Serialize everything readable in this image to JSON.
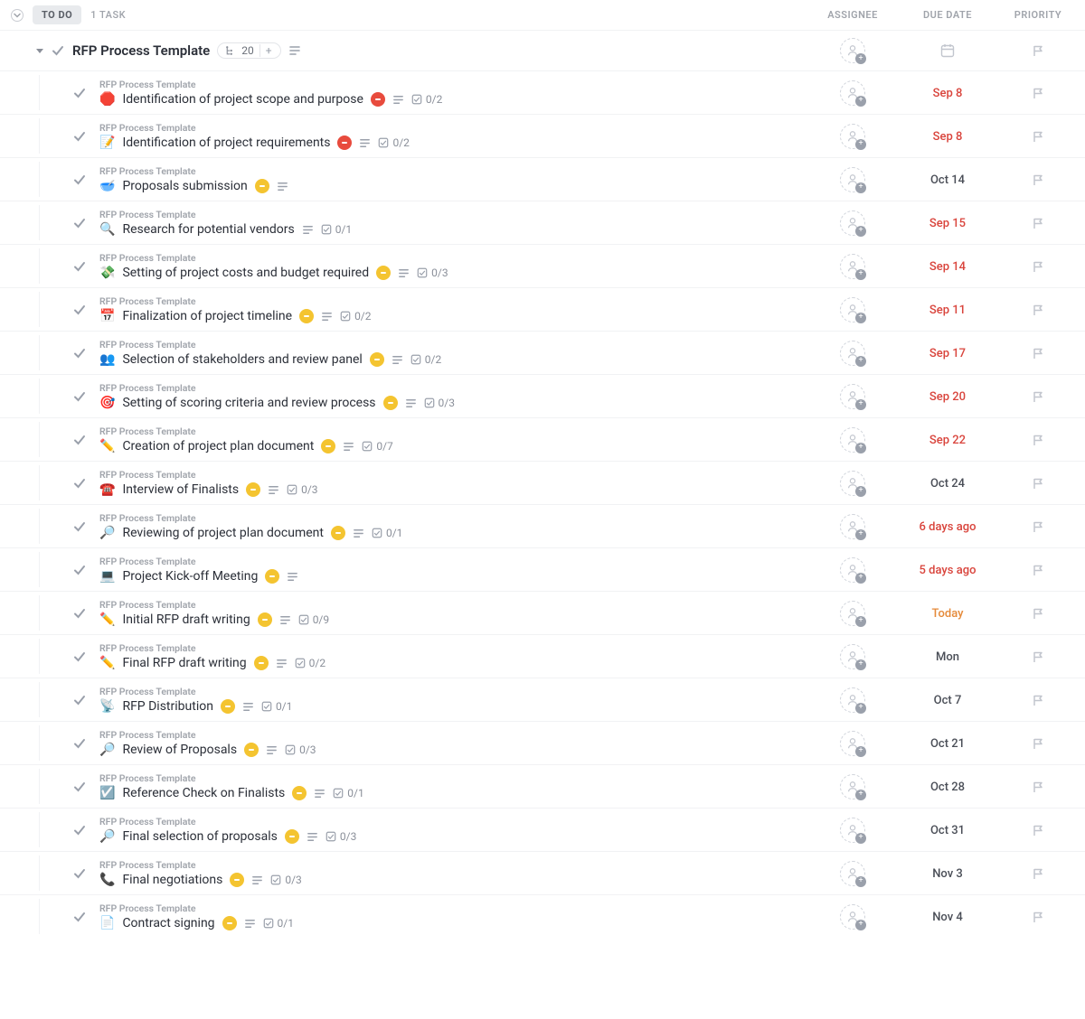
{
  "header": {
    "status_label": "TO DO",
    "task_count": "1 TASK",
    "columns": {
      "assignee": "ASSIGNEE",
      "due": "DUE DATE",
      "priority": "PRIORITY"
    }
  },
  "parent": {
    "title": "RFP Process Template",
    "subtask_count": "20"
  },
  "breadcrumb": "RFP Process Template",
  "tasks": [
    {
      "emoji": "🛑",
      "title": "Identification of project scope and purpose",
      "status": "red",
      "desc": true,
      "sub": "0/2",
      "due": "Sep 8",
      "due_style": "overdue"
    },
    {
      "emoji": "📝",
      "title": "Identification of project requirements",
      "status": "red",
      "desc": true,
      "sub": "0/2",
      "due": "Sep 8",
      "due_style": "overdue"
    },
    {
      "emoji": "🥣",
      "title": "Proposals submission",
      "status": "yellow",
      "desc": true,
      "sub": "",
      "due": "Oct 14",
      "due_style": "normal"
    },
    {
      "emoji": "🔍",
      "title": "Research for potential vendors",
      "status": "",
      "desc": true,
      "sub": "0/1",
      "due": "Sep 15",
      "due_style": "overdue"
    },
    {
      "emoji": "💸",
      "title": "Setting of project costs and budget required",
      "status": "yellow",
      "desc": true,
      "sub": "0/3",
      "due": "Sep 14",
      "due_style": "overdue"
    },
    {
      "emoji": "📅",
      "title": "Finalization of project timeline",
      "status": "yellow",
      "desc": true,
      "sub": "0/2",
      "due": "Sep 11",
      "due_style": "overdue"
    },
    {
      "emoji": "👥",
      "title": "Selection of stakeholders and review panel",
      "status": "yellow",
      "desc": true,
      "sub": "0/2",
      "due": "Sep 17",
      "due_style": "overdue"
    },
    {
      "emoji": "🎯",
      "title": "Setting of scoring criteria and review process",
      "status": "yellow",
      "desc": true,
      "sub": "0/3",
      "due": "Sep 20",
      "due_style": "overdue"
    },
    {
      "emoji": "✏️",
      "title": "Creation of project plan document",
      "status": "yellow",
      "desc": true,
      "sub": "0/7",
      "due": "Sep 22",
      "due_style": "overdue"
    },
    {
      "emoji": "☎️",
      "title": "Interview of Finalists",
      "status": "yellow",
      "desc": true,
      "sub": "0/3",
      "due": "Oct 24",
      "due_style": "normal"
    },
    {
      "emoji": "🔎",
      "title": "Reviewing of project plan document",
      "status": "yellow",
      "desc": true,
      "sub": "0/1",
      "due": "6 days ago",
      "due_style": "overdue"
    },
    {
      "emoji": "💻",
      "title": "Project Kick-off Meeting",
      "status": "yellow",
      "desc": true,
      "sub": "",
      "due": "5 days ago",
      "due_style": "overdue"
    },
    {
      "emoji": "✏️",
      "title": "Initial RFP draft writing",
      "status": "yellow",
      "desc": true,
      "sub": "0/9",
      "due": "Today",
      "due_style": "today"
    },
    {
      "emoji": "✏️",
      "title": "Final RFP draft writing",
      "status": "yellow",
      "desc": true,
      "sub": "0/2",
      "due": "Mon",
      "due_style": "normal"
    },
    {
      "emoji": "📡",
      "title": "RFP Distribution",
      "status": "yellow",
      "desc": true,
      "sub": "0/1",
      "due": "Oct 7",
      "due_style": "normal"
    },
    {
      "emoji": "🔎",
      "title": "Review of Proposals",
      "status": "yellow",
      "desc": true,
      "sub": "0/3",
      "due": "Oct 21",
      "due_style": "normal"
    },
    {
      "emoji": "☑️",
      "title": "Reference Check on Finalists",
      "status": "yellow",
      "desc": true,
      "sub": "0/1",
      "due": "Oct 28",
      "due_style": "normal"
    },
    {
      "emoji": "🔎",
      "title": "Final selection of proposals",
      "status": "yellow",
      "desc": true,
      "sub": "0/3",
      "due": "Oct 31",
      "due_style": "normal"
    },
    {
      "emoji": "📞",
      "title": "Final negotiations",
      "status": "yellow",
      "desc": true,
      "sub": "0/3",
      "due": "Nov 3",
      "due_style": "normal"
    },
    {
      "emoji": "📄",
      "title": "Contract signing",
      "status": "yellow",
      "desc": true,
      "sub": "0/1",
      "due": "Nov 4",
      "due_style": "normal"
    }
  ]
}
